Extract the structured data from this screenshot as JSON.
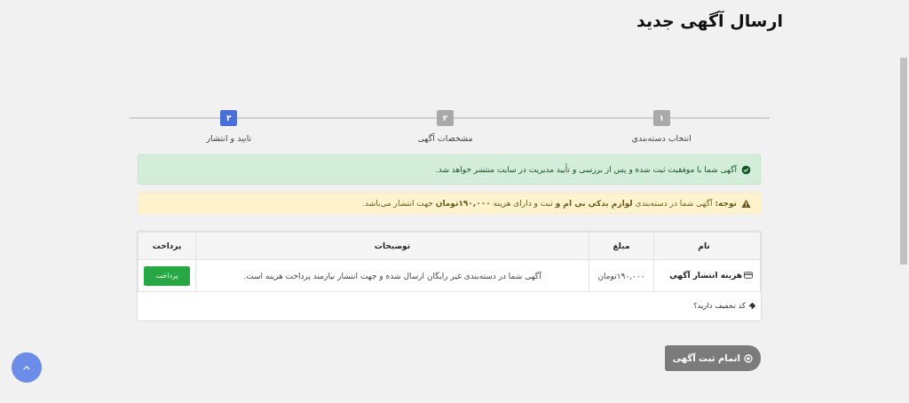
{
  "page_title": "ارسال آگهی جدید",
  "steps": [
    {
      "number": "۱",
      "label": "انتخاب دسته‌بندی",
      "selected": false
    },
    {
      "number": "۲",
      "label": "مشخصات آگهی",
      "selected": false
    },
    {
      "number": "۳",
      "label": "تایید و انتشار",
      "selected": true
    }
  ],
  "alerts": [
    {
      "kind": "success",
      "text": "آگهی شما با موفقیت ثبت شده و پس از بررسی و تأیید مدیریت در سایت منتشر خواهد شد."
    },
    {
      "kind": "warning",
      "text": "**توجه:** آگهی شما در دسته‌بندی **لوازم یدکی بی ام و** ثبت و دارای هزینه **۱۹۰,۰۰۰تومان** جهت انتشار می‌باشد."
    }
  ],
  "table": {
    "columns": [
      "نام",
      "مبلغ",
      "توضیحات",
      "پرداخت"
    ],
    "rows": [
      {
        "name": "هزینه انتشار آگهی",
        "amount": "۱۹۰,۰۰۰تومان",
        "description": "آگهی شما در دسته‌بندی غیر رایگان ارسال شده و جهت انتشار نیازمند پرداخت هزینه است.",
        "button": "پرداخت"
      }
    ],
    "discount_link": "کد تخفیف دارید؟"
  },
  "finish_button": "اتمام ثبت آگهی"
}
